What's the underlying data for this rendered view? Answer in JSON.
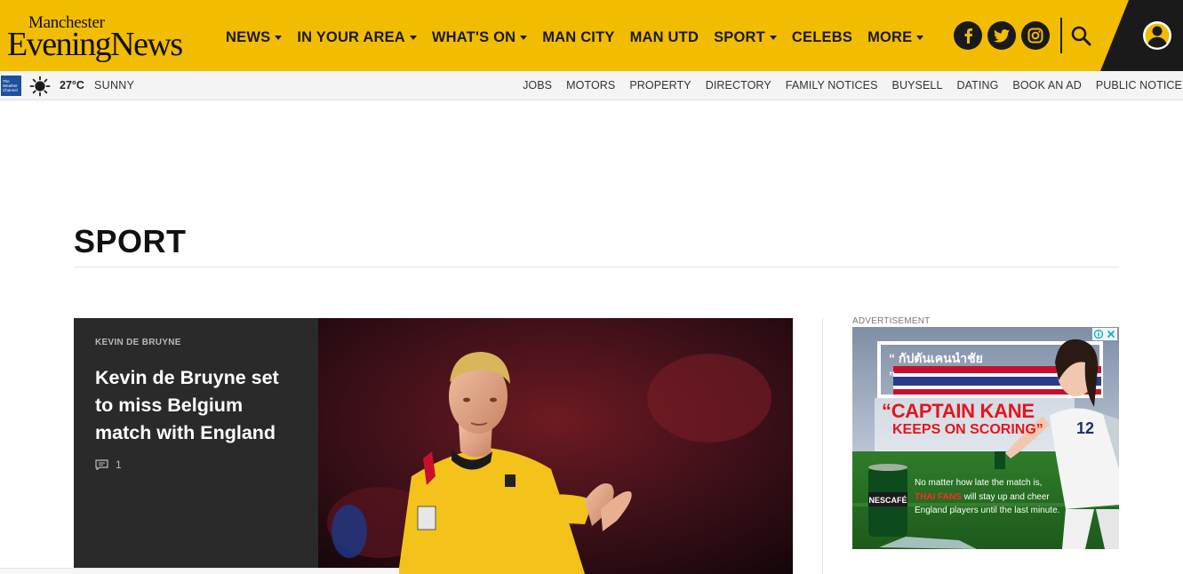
{
  "header": {
    "logo_line1": "Manchester",
    "logo_line2": "EveningNews",
    "nav": [
      {
        "label": "NEWS",
        "dropdown": true
      },
      {
        "label": "IN YOUR AREA",
        "dropdown": true
      },
      {
        "label": "WHAT'S ON",
        "dropdown": true
      },
      {
        "label": "MAN CITY",
        "dropdown": false
      },
      {
        "label": "MAN UTD",
        "dropdown": false
      },
      {
        "label": "SPORT",
        "dropdown": true
      },
      {
        "label": "CELEBS",
        "dropdown": false
      },
      {
        "label": "MORE",
        "dropdown": true
      }
    ],
    "social_icons": [
      "facebook-icon",
      "twitter-icon",
      "instagram-icon"
    ],
    "search_icon": "search-icon",
    "account_icon": "user-icon",
    "brand_color": "#f2bc00"
  },
  "subbar": {
    "weather_logo": "The Weather Channel",
    "weather_icon": "sun-icon",
    "temperature": "27°C",
    "condition": "SUNNY",
    "links": [
      "JOBS",
      "MOTORS",
      "PROPERTY",
      "DIRECTORY",
      "FAMILY NOTICES",
      "BUYSELL",
      "DATING",
      "BOOK AN AD",
      "PUBLIC NOTICE"
    ]
  },
  "section": {
    "title": "SPORT"
  },
  "lead_story": {
    "kicker": "KEVIN DE BRUYNE",
    "headline": "Kevin de Bruyne set to miss Belgium match with England",
    "comment_count": "1",
    "comment_icon": "comment-icon"
  },
  "advertisement": {
    "label": "ADVERTISEMENT",
    "title_th": "“ กัปตันเคนนำชัย ”",
    "title": "“CAPTAIN KANE",
    "subtitle": "KEEPS ON SCORING”",
    "body_1": "No matter how late the match is,",
    "body_hl": "THAI FANS",
    "body_2": "will stay up and cheer England players until the last minute.",
    "product": "NESCAFÉ",
    "shirt_number": "12",
    "close_icons": [
      "adchoices-icon",
      "close-icon"
    ]
  }
}
